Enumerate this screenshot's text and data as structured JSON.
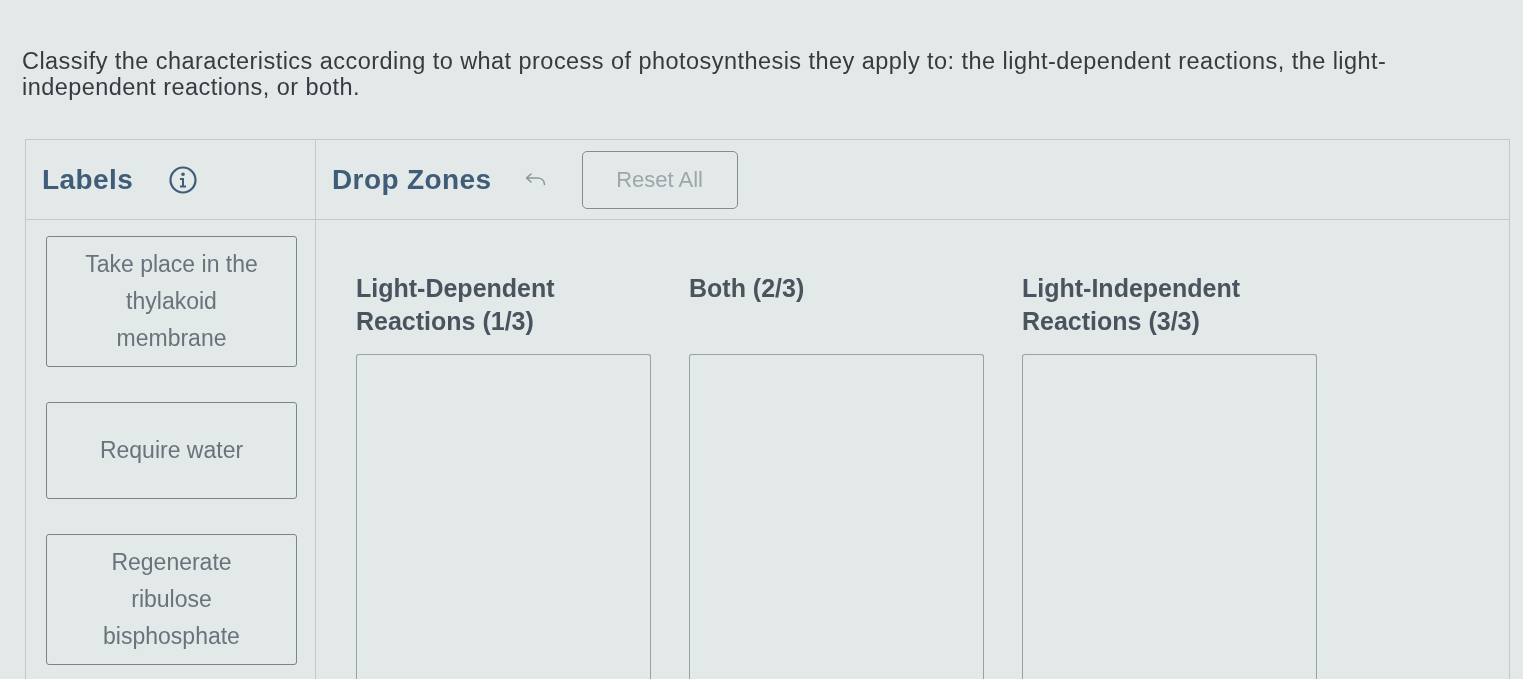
{
  "prompt": "Classify the characteristics according to what process of photosynthesis they apply to: the light-dependent reactions, the light-independent reactions, or both.",
  "labels_panel": {
    "title": "Labels"
  },
  "drop_zones_panel": {
    "title": "Drop Zones",
    "reset_button": {
      "label": "Reset All",
      "disabled": true
    }
  },
  "labels": [
    {
      "text": "Take place in the thylakoid membrane"
    },
    {
      "text": "Require water"
    },
    {
      "text": "Regenerate ribulose bisphosphate"
    }
  ],
  "drop_zones": [
    {
      "title": "Light-Dependent Reactions (1/3)"
    },
    {
      "title": "Both (2/3)"
    },
    {
      "title": "Light-Independent Reactions (3/3)"
    }
  ]
}
